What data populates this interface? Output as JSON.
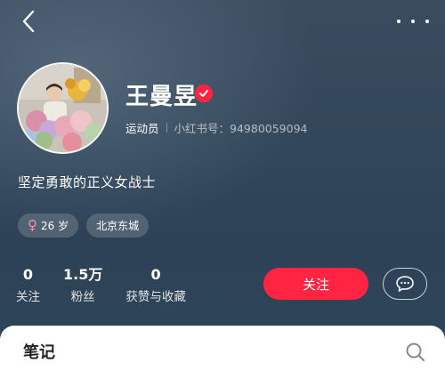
{
  "colors": {
    "accent": "#ff2442",
    "background": "#33475a",
    "sheet": "#ffffff",
    "female_symbol": "#ff8fa6"
  },
  "header": {
    "back_icon": "chevron-left-icon",
    "more_icon": "more-dots-icon"
  },
  "profile": {
    "name": "王曼昱",
    "verified_icon": "verified-badge-icon",
    "occupation": "运动员",
    "red_id": "小红书号：94980059094",
    "bio": "坚定勇敢的正义女战士",
    "tags": {
      "gender_symbol": "♀",
      "age": "26 岁",
      "location": "北京东城"
    }
  },
  "stats": [
    {
      "value": "0",
      "label": "关注"
    },
    {
      "value": "1.5万",
      "label": "粉丝"
    },
    {
      "value": "0",
      "label": "获赞与收藏"
    }
  ],
  "actions": {
    "follow_label": "关注",
    "message_icon": "chat-bubble-icon"
  },
  "notes_tab": {
    "title": "笔记",
    "search_icon": "search-icon"
  }
}
